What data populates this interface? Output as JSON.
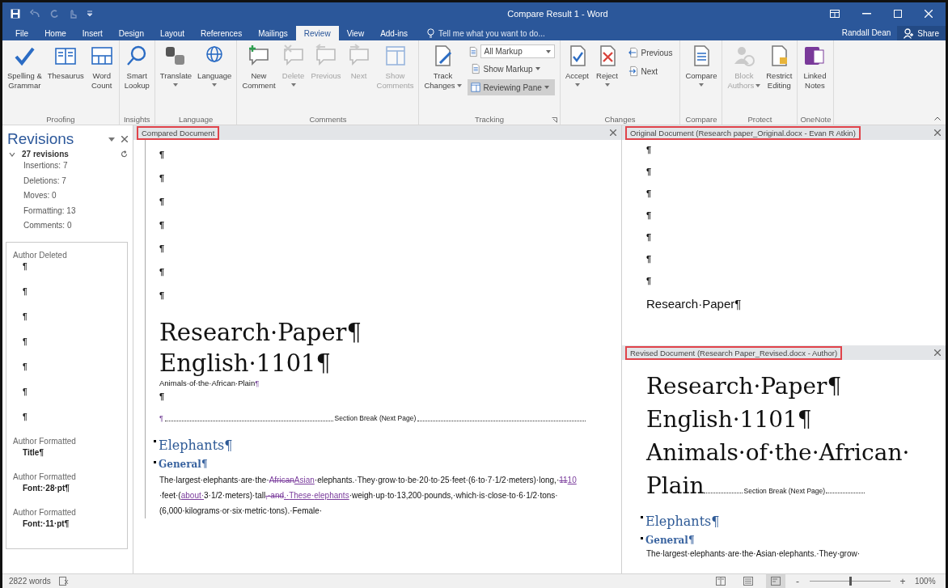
{
  "window": {
    "title": "Compare Result 1 - Word"
  },
  "tabs": [
    {
      "label": "File",
      "selected": false
    },
    {
      "label": "Home",
      "selected": false
    },
    {
      "label": "Insert",
      "selected": false
    },
    {
      "label": "Design",
      "selected": false
    },
    {
      "label": "Layout",
      "selected": false
    },
    {
      "label": "References",
      "selected": false
    },
    {
      "label": "Mailings",
      "selected": false
    },
    {
      "label": "Review",
      "selected": true
    },
    {
      "label": "View",
      "selected": false
    },
    {
      "label": "Add-ins",
      "selected": false
    }
  ],
  "tell_me": {
    "placeholder": "Tell me what you want to do..."
  },
  "user": "Randall Dean",
  "share": "Share",
  "ribbon": [
    {
      "label": "Proofing",
      "items": [
        {
          "kind": "large",
          "lines": [
            "Spelling &",
            "Grammar"
          ],
          "disabled": false,
          "dropdown": false
        },
        {
          "kind": "large",
          "lines": [
            "Thesaurus"
          ],
          "disabled": false,
          "dropdown": false
        },
        {
          "kind": "large",
          "lines": [
            "Word",
            "Count"
          ],
          "disabled": false,
          "dropdown": false
        }
      ]
    },
    {
      "label": "Insights",
      "items": [
        {
          "kind": "large",
          "lines": [
            "Smart",
            "Lookup"
          ],
          "disabled": false,
          "dropdown": false
        }
      ]
    },
    {
      "label": "Language",
      "items": [
        {
          "kind": "large",
          "lines": [
            "Translate"
          ],
          "disabled": false,
          "dropdown": true
        },
        {
          "kind": "large",
          "lines": [
            "Language"
          ],
          "disabled": false,
          "dropdown": true
        }
      ]
    },
    {
      "label": "Comments",
      "items": [
        {
          "kind": "large",
          "lines": [
            "New",
            "Comment"
          ],
          "disabled": false,
          "dropdown": false
        },
        {
          "kind": "large",
          "lines": [
            "Delete"
          ],
          "disabled": true,
          "dropdown": true
        },
        {
          "kind": "large",
          "lines": [
            "Previous"
          ],
          "disabled": true,
          "dropdown": false
        },
        {
          "kind": "large",
          "lines": [
            "Next"
          ],
          "disabled": true,
          "dropdown": false
        },
        {
          "kind": "large",
          "lines": [
            "Show",
            "Comments"
          ],
          "disabled": true,
          "dropdown": false
        }
      ]
    },
    {
      "label": "Tracking",
      "launcher": true,
      "items": [
        {
          "kind": "large",
          "lines": [
            "Track",
            "Changes"
          ],
          "disabled": false,
          "dropdown": true
        },
        {
          "kind": "stack",
          "items": [
            {
              "kind": "select",
              "label": "All Markup",
              "selected": false
            },
            {
              "kind": "small",
              "label": "Show Markup",
              "dropdown": true,
              "selected": false
            },
            {
              "kind": "small",
              "label": "Reviewing Pane",
              "dropdown": true,
              "selected": true
            }
          ]
        }
      ]
    },
    {
      "label": "Changes",
      "launcher": false,
      "items": [
        {
          "kind": "large",
          "lines": [
            "Accept"
          ],
          "disabled": false,
          "dropdown": true
        },
        {
          "kind": "large",
          "lines": [
            "Reject"
          ],
          "disabled": false,
          "dropdown": true
        },
        {
          "kind": "stack",
          "items": [
            {
              "kind": "small",
              "label": "Previous",
              "dropdown": false,
              "selected": false
            },
            {
              "kind": "small",
              "label": "Next",
              "dropdown": false,
              "selected": false
            }
          ]
        }
      ]
    },
    {
      "label": "Compare",
      "items": [
        {
          "kind": "large",
          "lines": [
            "Compare"
          ],
          "disabled": false,
          "dropdown": true
        }
      ]
    },
    {
      "label": "Protect",
      "items": [
        {
          "kind": "large",
          "lines": [
            "Block",
            "Authors"
          ],
          "disabled": true,
          "dropdown": true
        },
        {
          "kind": "large",
          "lines": [
            "Restrict",
            "Editing"
          ],
          "disabled": false,
          "dropdown": false
        }
      ]
    },
    {
      "label": "OneNote",
      "items": [
        {
          "kind": "large",
          "lines": [
            "Linked",
            "Notes"
          ],
          "disabled": false,
          "dropdown": false
        }
      ]
    }
  ],
  "revisions": {
    "title": "Revisions",
    "summary": "27 revisions",
    "expanded": true,
    "counts": [
      "Insertions: 7",
      "Deletions: 7",
      "Moves: 0",
      "Formatting: 13",
      "Comments: 0"
    ],
    "entries": [
      {
        "author": "Author Deleted",
        "lines": [
          "¶",
          "¶",
          "¶",
          "¶",
          "¶",
          "¶",
          "¶"
        ]
      },
      {
        "author": "Author Formatted",
        "lines": [
          "Title¶"
        ]
      },
      {
        "author": "Author Formatted",
        "lines": [
          "Font:·28·pt¶"
        ]
      },
      {
        "author": "Author Formatted",
        "lines": [
          "Font:·11·pt¶"
        ]
      }
    ]
  },
  "compared": {
    "title": "Compared Document",
    "outlined": true,
    "blocks": [
      {
        "kind": "pilcrow",
        "text": "¶"
      },
      {
        "kind": "pilcrow",
        "text": "¶"
      },
      {
        "kind": "pilcrow",
        "text": "¶"
      },
      {
        "kind": "pilcrow",
        "text": "¶"
      },
      {
        "kind": "pilcrow",
        "text": "¶"
      },
      {
        "kind": "pilcrow",
        "text": "¶"
      },
      {
        "kind": "pilcrow",
        "text": "¶"
      },
      {
        "kind": "title",
        "text": "Research·Paper¶"
      },
      {
        "kind": "title",
        "text": "English·1101¶"
      },
      {
        "kind": "small",
        "text": "Animals·of·the·African·Plain",
        "mark": "¶"
      },
      {
        "kind": "pilcrow",
        "text": "¶"
      },
      {
        "kind": "section_break",
        "mark": "¶",
        "text": "Section Break (Next Page)"
      },
      {
        "kind": "heading1",
        "text": "Elephants¶"
      },
      {
        "kind": "heading2",
        "text": "General¶"
      },
      {
        "kind": "body",
        "segments": [
          {
            "kind": "plain",
            "text": "The·largest·elephants·are·the·"
          },
          {
            "kind": "del",
            "text": "African"
          },
          {
            "kind": "ins",
            "text": "Asian"
          },
          {
            "kind": "plain",
            "text": "·elephants.·They·grow·to·be·20·to·25·feet·(6·to·7·1/2·meters)·long,·"
          },
          {
            "kind": "del",
            "text": "11"
          },
          {
            "kind": "ins",
            "text": "10"
          },
          {
            "kind": "plain",
            "text": "·feet·("
          },
          {
            "kind": "ins",
            "text": "about·"
          },
          {
            "kind": "plain",
            "text": "3·1/2·meters)·tall"
          },
          {
            "kind": "del",
            "text": ",·and"
          },
          {
            "kind": "ins",
            "text": ".·These·elephants"
          },
          {
            "kind": "plain",
            "text": "·weigh·up·to·13,200·pounds,·which·is·close·to·6·1/2·tons·(6,000·kilograms·or·six·metric·tons).·Female·"
          }
        ]
      }
    ]
  },
  "original": {
    "title": "Original Document (Research paper_Original.docx - Evan R Atkin)",
    "outlined": true,
    "blocks": [
      {
        "kind": "pilcrow",
        "text": "¶"
      },
      {
        "kind": "pilcrow",
        "text": "¶"
      },
      {
        "kind": "pilcrow",
        "text": "¶"
      },
      {
        "kind": "pilcrow",
        "text": "¶"
      },
      {
        "kind": "pilcrow",
        "text": "¶"
      },
      {
        "kind": "pilcrow",
        "text": "¶"
      },
      {
        "kind": "pilcrow",
        "text": "¶"
      },
      {
        "kind": "subtitle",
        "text": "Research·Paper¶"
      }
    ]
  },
  "revised": {
    "title": "Revised Document (Research Paper_Revised.docx - Author)",
    "outlined": true,
    "blocks": [
      {
        "kind": "big",
        "text": "Research·Paper¶"
      },
      {
        "kind": "big",
        "text": "English·1101¶"
      },
      {
        "kind": "big_break",
        "text": "Animals·of·the·African·Plain",
        "break": "Section Break (Next Page)"
      },
      {
        "kind": "heading1",
        "text": "Elephants¶"
      },
      {
        "kind": "heading2",
        "text": "General¶"
      },
      {
        "kind": "body",
        "segments": [
          {
            "kind": "plain",
            "text": "The·largest·elephants·are·the·Asian·elephants.·They·grow·"
          }
        ]
      }
    ]
  },
  "status": {
    "words": "2822 words",
    "views": [
      {
        "selected": false
      },
      {
        "selected": false
      },
      {
        "selected": true
      }
    ],
    "zoom_out": "-",
    "zoom_in": "+",
    "zoom": {
      "level": 0.5
    },
    "zoom_text": "100%"
  }
}
